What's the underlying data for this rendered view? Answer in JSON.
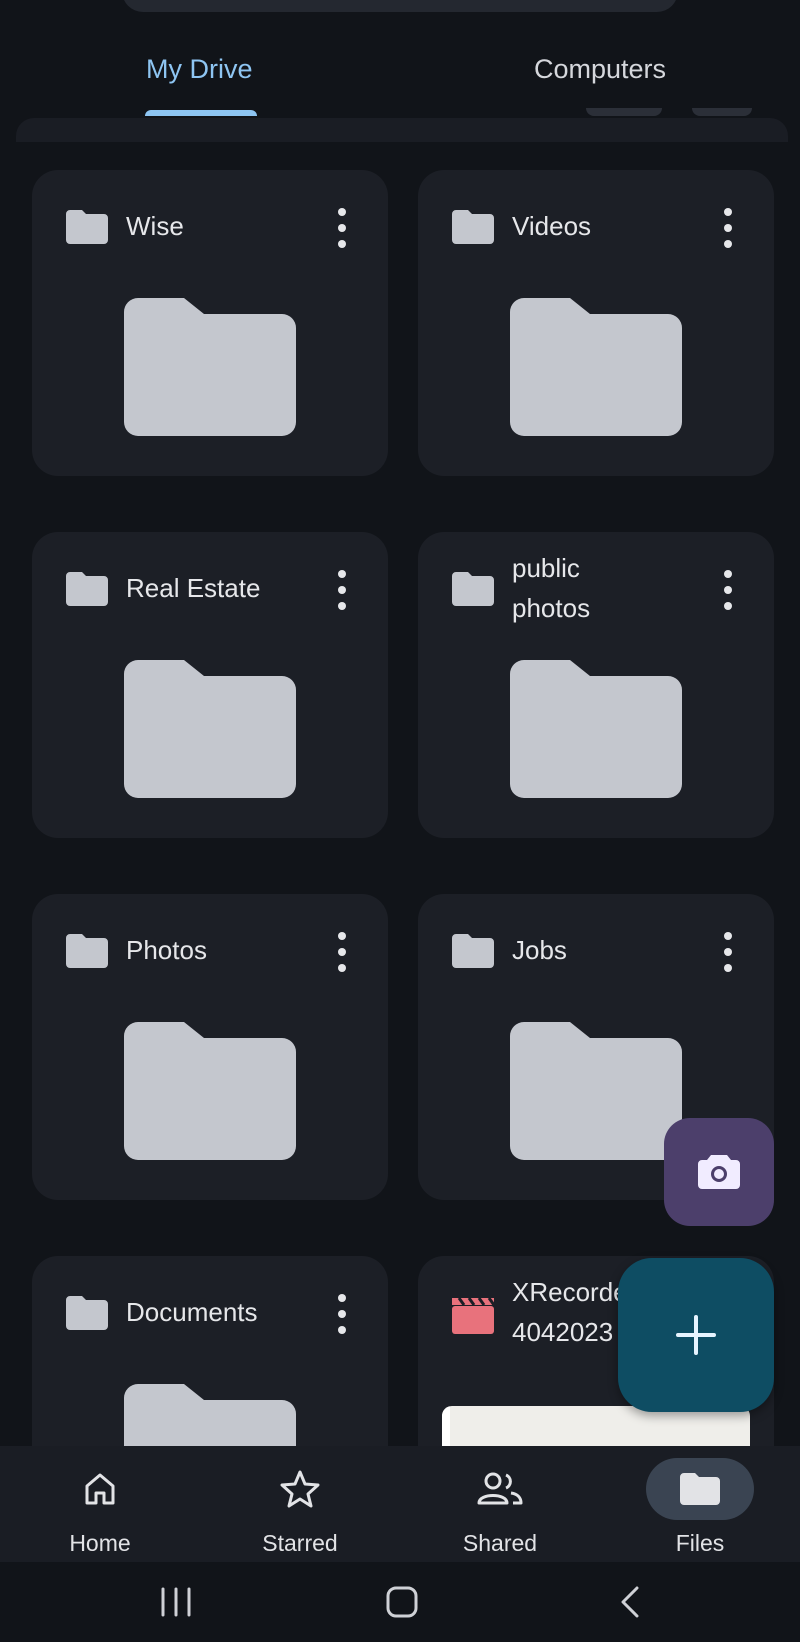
{
  "tabs": [
    {
      "label": "My Drive",
      "active": true
    },
    {
      "label": "Computers",
      "active": false
    }
  ],
  "items": [
    {
      "name": "Wise",
      "type": "folder"
    },
    {
      "name": "Videos",
      "type": "folder"
    },
    {
      "name": "Real Estate",
      "type": "folder"
    },
    {
      "name": "public photos",
      "type": "folder"
    },
    {
      "name": "Photos",
      "type": "folder"
    },
    {
      "name": "Jobs",
      "type": "folder"
    },
    {
      "name": "Documents",
      "type": "folder"
    },
    {
      "name": "XRecorder 4042023",
      "type": "video",
      "icon": "video-file-icon",
      "icon_color": "#e8727c"
    }
  ],
  "fabs": {
    "camera_icon": "camera-icon",
    "new_icon": "plus-icon",
    "camera_color": "#4c3f6b",
    "new_color": "#0e4d63"
  },
  "bottom_nav": [
    {
      "label": "Home",
      "icon": "home-icon"
    },
    {
      "label": "Starred",
      "icon": "star-icon"
    },
    {
      "label": "Shared",
      "icon": "people-icon"
    },
    {
      "label": "Files",
      "icon": "folder-icon",
      "active": true
    }
  ],
  "system_nav": [
    "recents-icon",
    "home-button-icon",
    "back-icon"
  ],
  "colors": {
    "background": "#111419",
    "card": "#1c1f26",
    "folder_icon": "#c4c7ce",
    "active_tab": "#8ec5f2"
  }
}
